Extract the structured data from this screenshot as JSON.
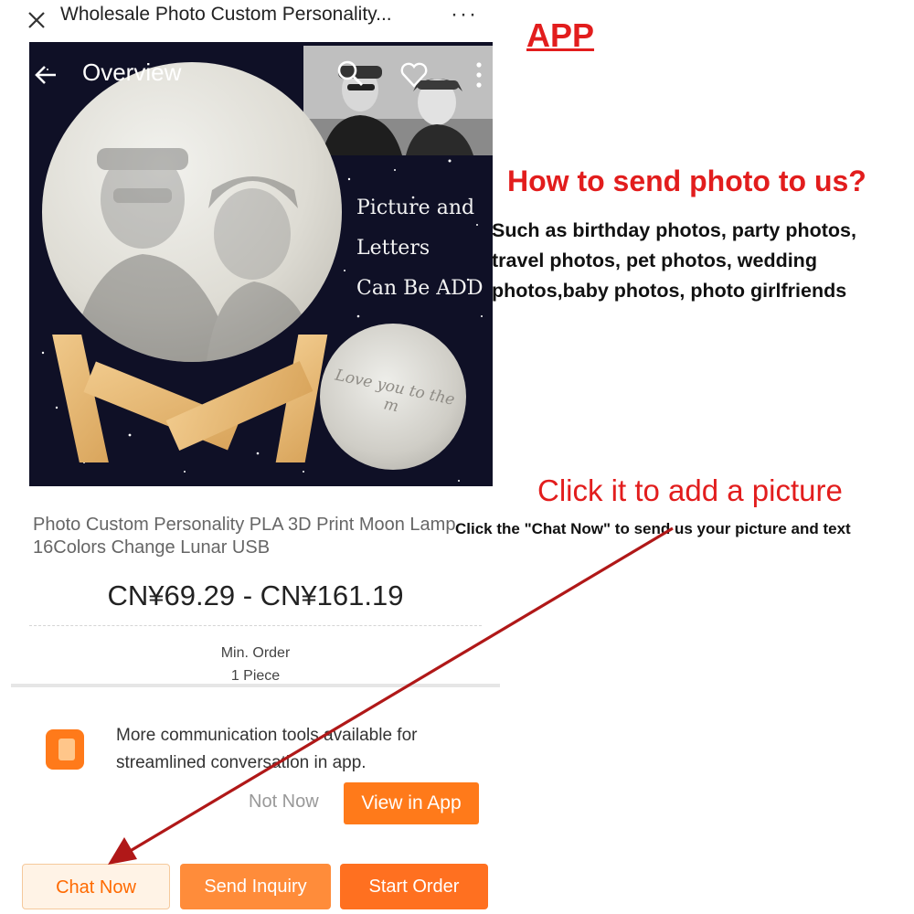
{
  "window": {
    "title": "Wholesale Photo Custom Personality...",
    "close_icon": "close-icon",
    "more_icon": "more-horizontal-icon",
    "more_glyph": "···"
  },
  "gallery": {
    "nav_title": "Overview",
    "back_icon": "arrow-left-icon",
    "search_icon": "search-icon",
    "favorite_icon": "heart-icon",
    "menu_icon": "more-vertical-icon",
    "caption_lines": [
      "Picture and",
      "Letters",
      "Can Be ADD"
    ],
    "moon_script": "Love you to the m",
    "image_count": 6,
    "active_index": 0
  },
  "product": {
    "title": "Photo Custom Personality PLA 3D Print Moon Lamp 16Colors Change Lunar USB",
    "price": "CN¥69.29 - CN¥161.19",
    "min_order_label": "Min. Order",
    "min_order_value": "1 Piece"
  },
  "app_prompt": {
    "icon": "app-icon",
    "text": "More communication tools available for streamlined conversation in app.",
    "not_now": "Not Now",
    "view_in_app": "View in App"
  },
  "bottom_bar": {
    "chat_now": "Chat Now",
    "send_inquiry": "Send Inquiry",
    "start_order": "Start Order"
  },
  "annotations": {
    "app_tag": "APP",
    "how_to": "How to send photo to us?",
    "examples_lines": [
      "Such as birthday photos, party photos,",
      "travel photos, pet photos, wedding",
      "photos,baby photos, photo girlfriends"
    ],
    "click_heading": "Click it to add a picture",
    "click_sub": "Click the \"Chat Now\" to send us your picture and text",
    "arrow_color": "#b01818"
  },
  "colors": {
    "accent": "#ff7a1a",
    "annotation_red": "#e21d1d"
  }
}
